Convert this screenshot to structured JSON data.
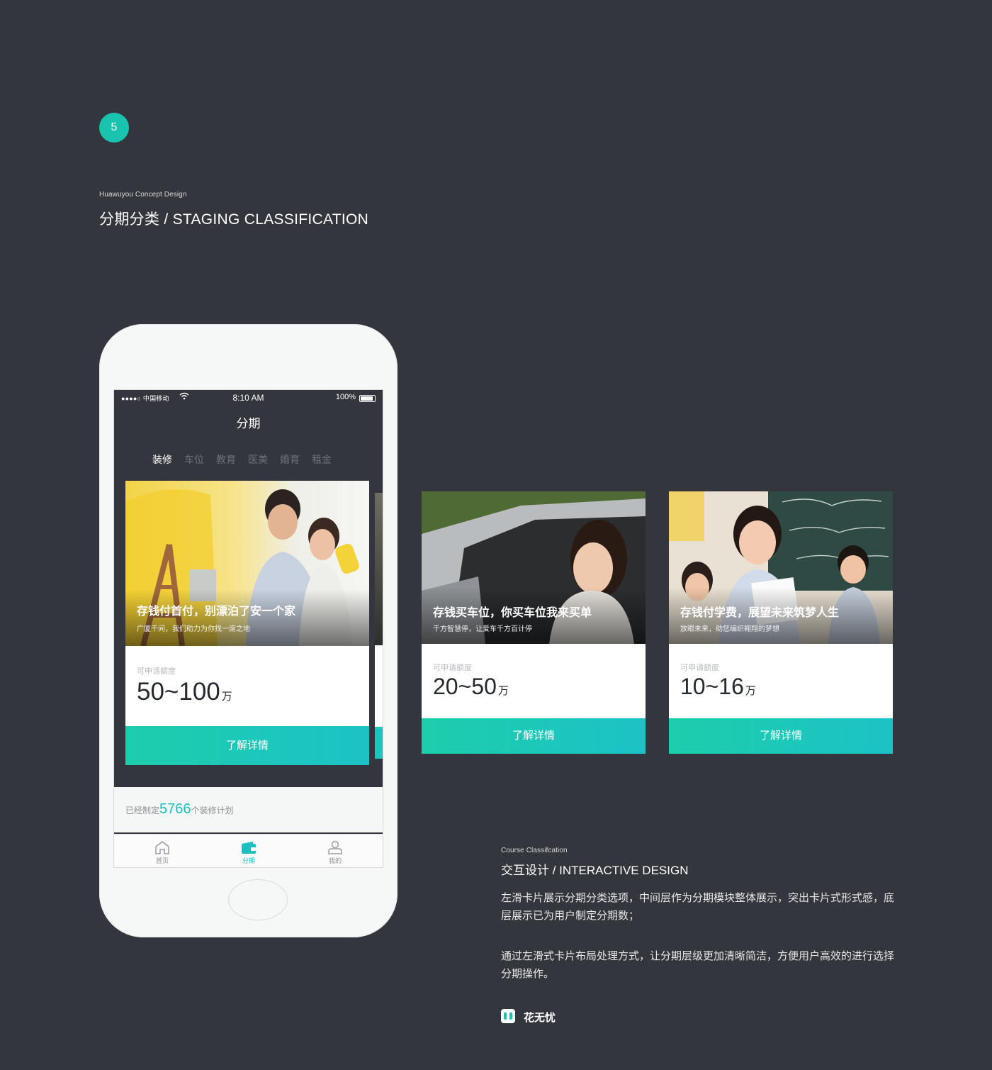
{
  "step": {
    "number": "5"
  },
  "section1": {
    "kicker": "Huawuyou Concept Design",
    "title": "分期分类 / STAGING CLASSIFICATION"
  },
  "phone": {
    "status": {
      "carrier": "●●●●○ 中国移动",
      "time": "8:10 AM",
      "battery": "100%"
    },
    "nav_title": "分期",
    "tabs": [
      {
        "label": "装修",
        "active": true
      },
      {
        "label": "车位",
        "active": false
      },
      {
        "label": "教育",
        "active": false
      },
      {
        "label": "医美",
        "active": false
      },
      {
        "label": "婚育",
        "active": false
      },
      {
        "label": "租金",
        "active": false
      }
    ],
    "card": {
      "headline": "存钱付首付，别漂泊了安一个家",
      "subline": "广厦千间，我们助力为你找一席之地",
      "label": "可申请额度",
      "amount": "50~100",
      "unit": "万",
      "cta": "了解详情"
    },
    "plans": {
      "prefix": "已经制定",
      "count": "5766",
      "suffix": "个装修计划"
    },
    "tabbar": [
      {
        "label": "首页",
        "icon": "home-icon",
        "active": false
      },
      {
        "label": "分期",
        "icon": "wallet-icon",
        "active": true
      },
      {
        "label": "我的",
        "icon": "user-icon",
        "active": false
      }
    ]
  },
  "cards": [
    {
      "headline": "存钱买车位，你买车位我来买单",
      "subline": "千方智慧停，让爱车千方百计停",
      "label": "可申请额度",
      "amount": "20~50",
      "unit": "万",
      "cta": "了解详情"
    },
    {
      "headline": "存钱付学费，展望未来筑梦人生",
      "subline": "放眼未来，助您编织翱翔的梦想",
      "label": "可申请额度",
      "amount": "10~16",
      "unit": "万",
      "cta": "了解详情"
    }
  ],
  "section2": {
    "kicker": "Course Classifcation",
    "title": "交互设计 / INTERACTIVE DESIGN",
    "paragraph1": "左滑卡片展示分期分类选项，中间层作为分期模块整体展示，突出卡片式形式感，底层展示已为用户制定分期数；",
    "paragraph2": "通过左滑式卡片布局处理方式，让分期层级更加清晰简洁，方便用户高效的进行选择分期操作。"
  },
  "brand": {
    "name": "花无忧"
  },
  "colors": {
    "background": "#33363d",
    "accent": "#19c3b0",
    "cta_start": "#1cceaa",
    "cta_end": "#1cc2c7"
  }
}
